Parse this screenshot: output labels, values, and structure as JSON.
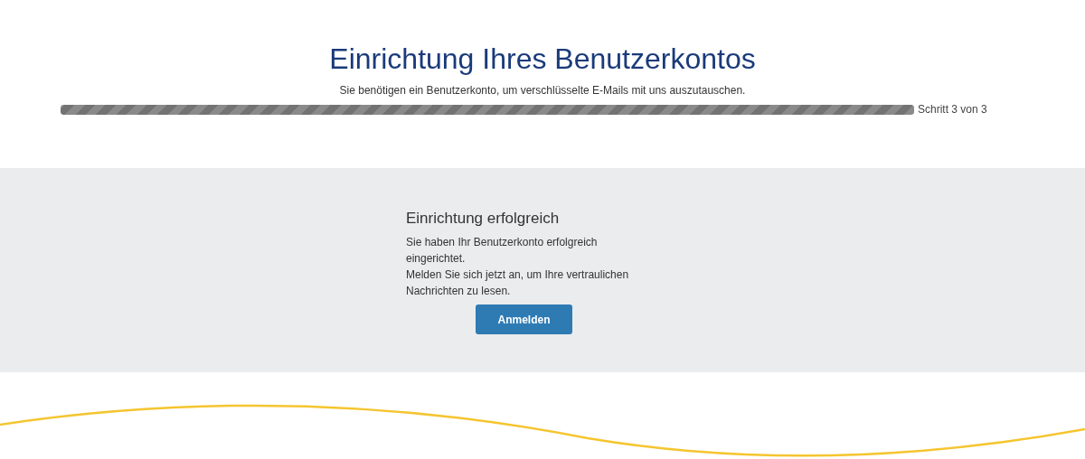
{
  "header": {
    "title": "Einrichtung Ihres Benutzerkontos",
    "subtitle": "Sie benötigen ein Benutzerkonto, um verschlüsselte E-Mails mit uns auszutauschen."
  },
  "progress": {
    "level": 1,
    "label": "Schritt 3 von 3"
  },
  "panel": {
    "heading": "Einrichtung erfolgreich",
    "paragraphs": [
      "Sie haben Ihr Benutzerkonto erfolgreich eingerichtet.",
      "Melden Sie sich jetzt an, um Ihre vertraulichen Nachrichten zu lesen."
    ],
    "button": "Anmelden"
  }
}
